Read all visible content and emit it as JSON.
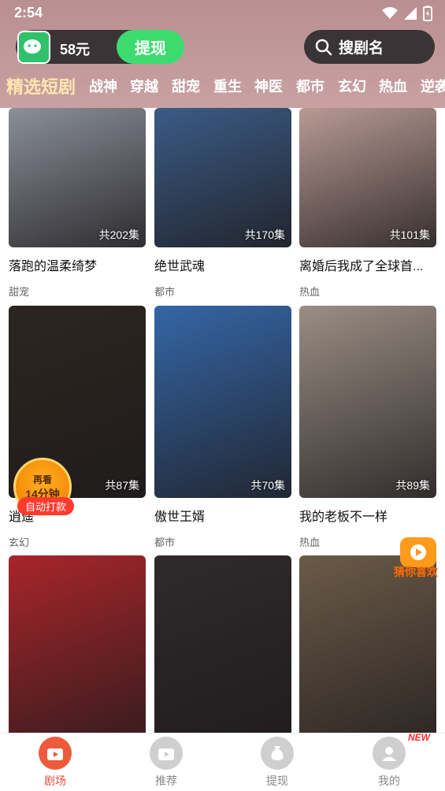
{
  "status_bar": {
    "time": "2:54"
  },
  "header": {
    "wallet_amount": "58元",
    "withdraw_label": "提现",
    "search_placeholder": "搜剧名",
    "categories": [
      "精选短剧",
      "战神",
      "穿越",
      "甜宠",
      "重生",
      "神医",
      "都市",
      "玄幻",
      "热血",
      "逆袭"
    ]
  },
  "dramas": [
    {
      "title": "落跑的温柔绮梦",
      "genre": "甜宠",
      "episodes": "共202集",
      "tint": "#8a8f99"
    },
    {
      "title": "绝世武魂",
      "genre": "都市",
      "episodes": "共170集",
      "tint": "#3b5b86"
    },
    {
      "title": "离婚后我成了全球首...",
      "genre": "热血",
      "episodes": "共101集",
      "tint": "#b89a94"
    },
    {
      "title": "逍遥",
      "genre": "玄幻",
      "episodes": "共87集",
      "tint": "#2d2520"
    },
    {
      "title": "傲世王婿",
      "genre": "都市",
      "episodes": "共70集",
      "tint": "#3566a6"
    },
    {
      "title": "我的老板不一样",
      "genre": "热血",
      "episodes": "共89集",
      "tint": "#9a8e84"
    },
    {
      "title": "",
      "genre": "",
      "episodes": "",
      "tint": "#a8252a"
    },
    {
      "title": "",
      "genre": "",
      "episodes": "",
      "tint": "#2f2a2c"
    },
    {
      "title": "",
      "genre": "",
      "episodes": "",
      "tint": "#6b5a48"
    }
  ],
  "reward_badge": {
    "line1": "再看",
    "line2": "14分钟",
    "tag": "自动打款"
  },
  "float_widget": {
    "label": "猜你喜欢"
  },
  "tabbar": {
    "items": [
      {
        "label": "剧场",
        "icon": "theater-icon"
      },
      {
        "label": "推荐",
        "icon": "tv-icon"
      },
      {
        "label": "提现",
        "icon": "money-bag-icon"
      },
      {
        "label": "我的",
        "icon": "profile-icon"
      }
    ],
    "new_label": "NEW"
  }
}
